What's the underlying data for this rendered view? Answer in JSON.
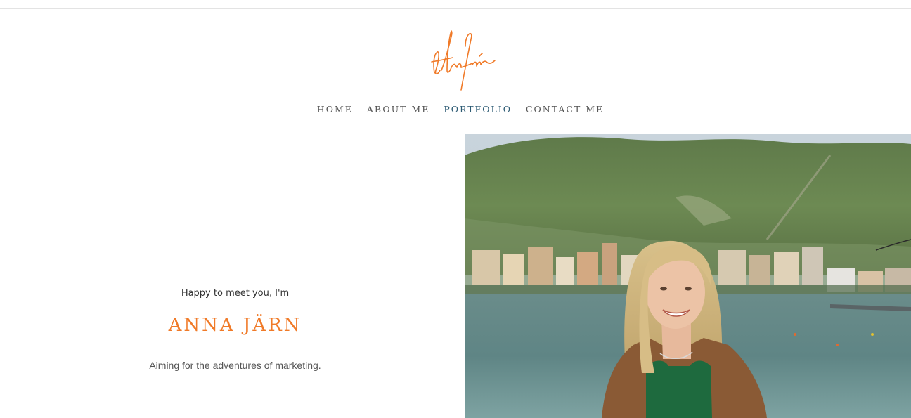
{
  "site": {
    "logo_text": "Anna Järn"
  },
  "nav": {
    "items": [
      {
        "label": "HOME"
      },
      {
        "label": "ABOUT ME"
      },
      {
        "label": "PORTFOLIO"
      },
      {
        "label": "CONTACT ME"
      }
    ]
  },
  "hero": {
    "greeting": "Happy to meet you, I'm",
    "name": "ANNA JÄRN",
    "tagline": "Aiming for the adventures of marketing."
  },
  "colors": {
    "accent": "#f07a28",
    "nav_active": "#2c5a73",
    "text": "#333333"
  },
  "icons": {
    "logo": "signature-logo"
  }
}
